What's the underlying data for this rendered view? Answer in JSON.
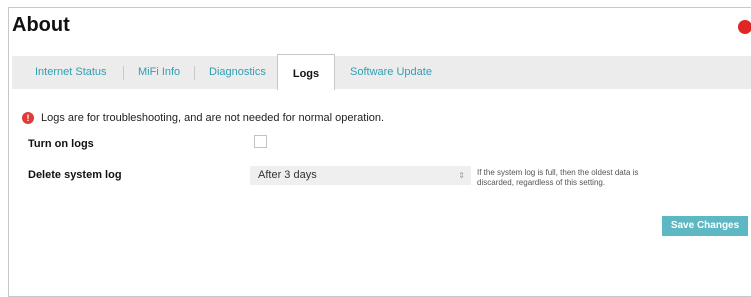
{
  "page": {
    "title": "About"
  },
  "tabs": [
    {
      "label": "Internet Status",
      "active": false
    },
    {
      "label": "MiFi Info",
      "active": false
    },
    {
      "label": "Diagnostics",
      "active": false
    },
    {
      "label": "Logs",
      "active": true
    },
    {
      "label": "Software Update",
      "active": false
    }
  ],
  "notice": {
    "icon": "exclamation-icon",
    "icon_glyph": "!",
    "text": "Logs are for troubleshooting, and are not needed for normal operation."
  },
  "settings": {
    "turn_on_logs": {
      "label": "Turn on logs",
      "checked": false
    },
    "delete_system_log": {
      "label": "Delete system log",
      "selected": "After 3 days",
      "arrows": "⇕",
      "help": "If the system log is full, then the oldest data is discarded, regardless of this setting."
    }
  },
  "actions": {
    "save_label": "Save Changes"
  },
  "colors": {
    "accent": "#5eb8c4",
    "tab_link": "#2f9fb2",
    "alert": "#df3b3b"
  }
}
